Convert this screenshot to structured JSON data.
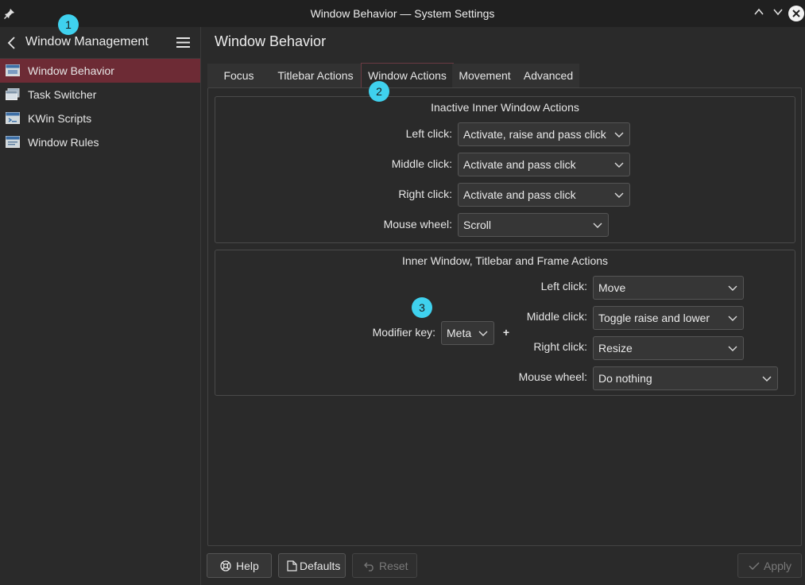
{
  "window": {
    "title": "Window Behavior — System Settings",
    "pin_icon": "pin-icon",
    "buttons": [
      "chevron-up-icon",
      "chevron-down-icon",
      "close-icon"
    ]
  },
  "sidebar": {
    "header_label": "Window Management",
    "items": [
      {
        "label": "Window Behavior",
        "icon": "window-icon",
        "active": true
      },
      {
        "label": "Task Switcher",
        "icon": "task-switcher-icon",
        "active": false
      },
      {
        "label": "KWin Scripts",
        "icon": "script-icon",
        "active": false
      },
      {
        "label": "Window Rules",
        "icon": "window-rules-icon",
        "active": false
      }
    ]
  },
  "main": {
    "title": "Window Behavior",
    "tabs": [
      {
        "label": "Focus",
        "active": false
      },
      {
        "label": "Titlebar Actions",
        "active": false
      },
      {
        "label": "Window Actions",
        "active": true
      },
      {
        "label": "Movement",
        "active": false
      },
      {
        "label": "Advanced",
        "active": false
      }
    ],
    "inactive_group": {
      "title": "Inactive Inner Window Actions",
      "rows": [
        {
          "label": "Left click:",
          "value": "Activate, raise and pass click"
        },
        {
          "label": "Middle click:",
          "value": "Activate and pass click"
        },
        {
          "label": "Right click:",
          "value": "Activate and pass click"
        },
        {
          "label": "Mouse wheel:",
          "value": "Scroll"
        }
      ]
    },
    "inner_group": {
      "title": "Inner Window, Titlebar and Frame Actions",
      "modifier_label": "Modifier key:",
      "modifier_value": "Meta",
      "plus": "+",
      "rows": [
        {
          "label": "Left click:",
          "value": "Move"
        },
        {
          "label": "Middle click:",
          "value": "Toggle raise and lower"
        },
        {
          "label": "Right click:",
          "value": "Resize"
        },
        {
          "label": "Mouse wheel:",
          "value": "Do nothing"
        }
      ]
    }
  },
  "footer": {
    "help": "Help",
    "defaults": "Defaults",
    "reset": "Reset",
    "apply": "Apply"
  },
  "markers": [
    "1",
    "2",
    "3"
  ],
  "colors": {
    "accent": "#6d2b35",
    "marker": "#3fd1ee"
  }
}
